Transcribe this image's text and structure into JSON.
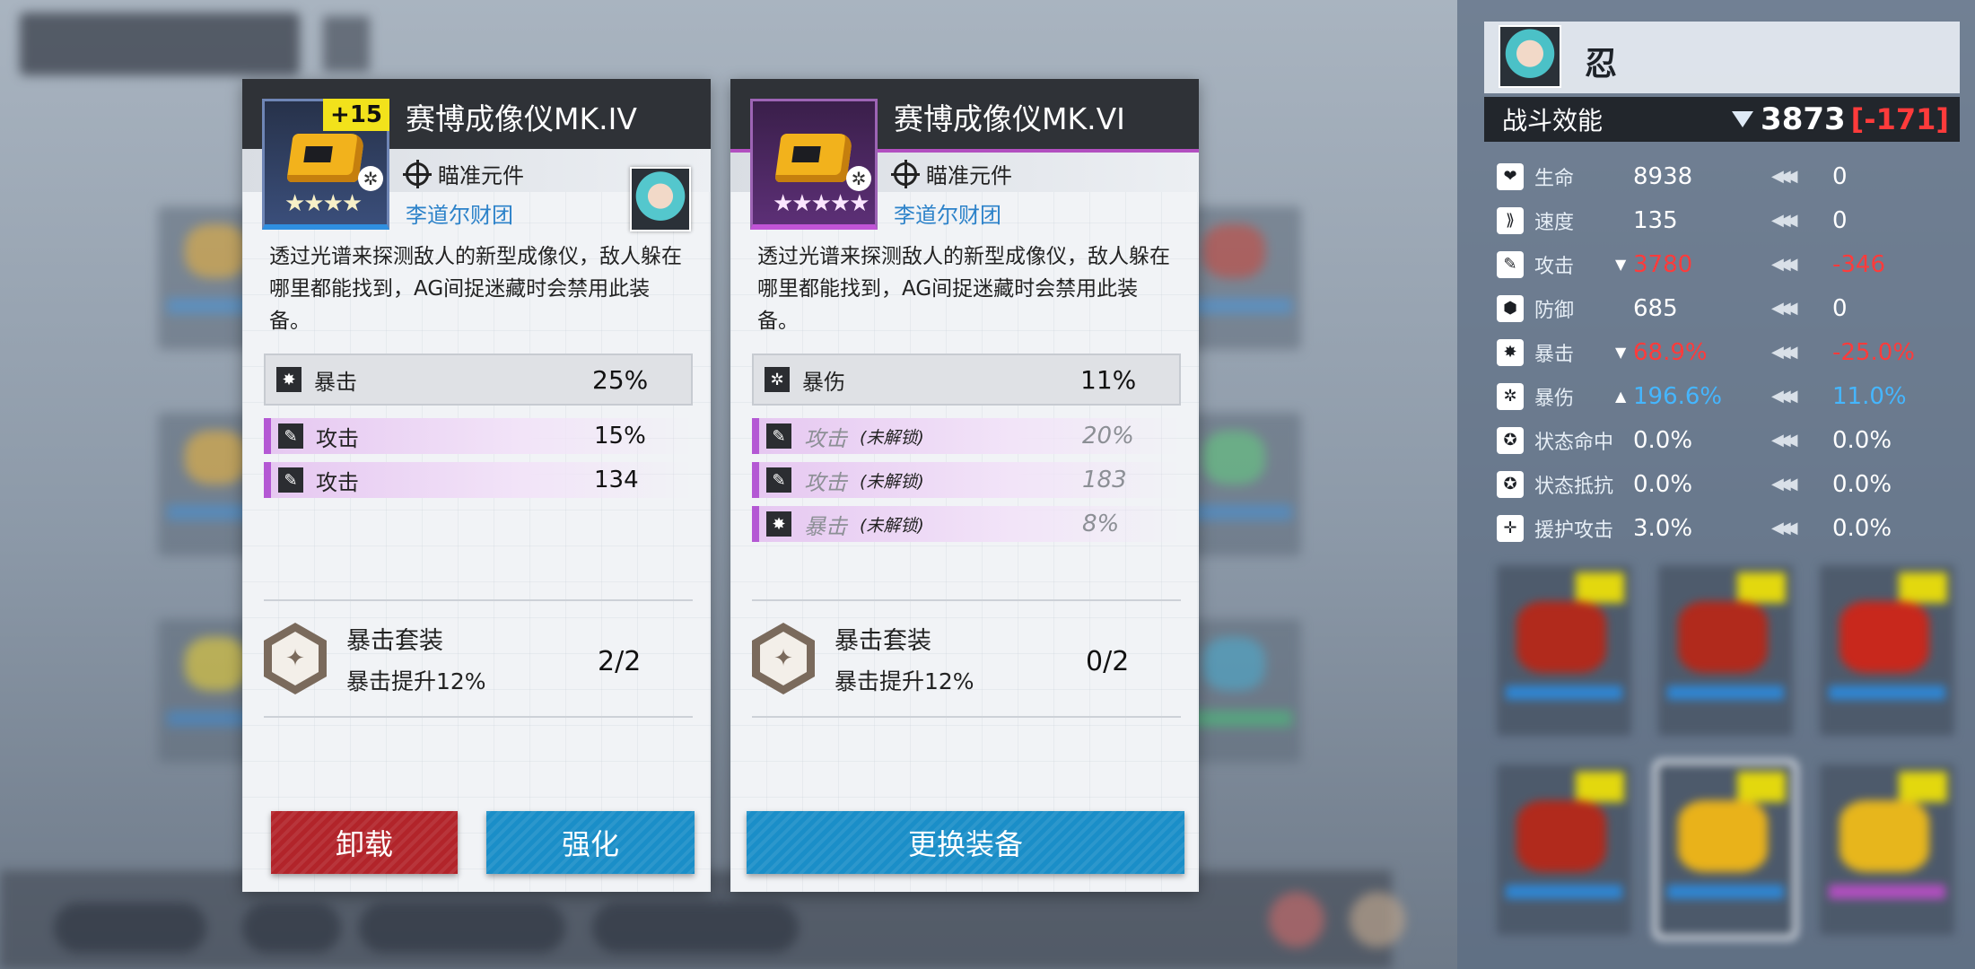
{
  "character": {
    "name": "忍",
    "power_label": "战斗效能",
    "power_value": "3873",
    "power_diff": "[-171]"
  },
  "stats": [
    {
      "icon": "heart-icon",
      "glyph": "❤",
      "name": "生命",
      "arrow": "",
      "value": "8938",
      "diff": "0",
      "trend": ""
    },
    {
      "icon": "speed-icon",
      "glyph": "⟫",
      "name": "速度",
      "arrow": "",
      "value": "135",
      "diff": "0",
      "trend": ""
    },
    {
      "icon": "attack-icon",
      "glyph": "✎",
      "name": "攻击",
      "arrow": "▼",
      "value": "3780",
      "diff": "-346",
      "trend": "down"
    },
    {
      "icon": "defense-icon",
      "glyph": "⬢",
      "name": "防御",
      "arrow": "",
      "value": "685",
      "diff": "0",
      "trend": ""
    },
    {
      "icon": "crit-icon",
      "glyph": "✸",
      "name": "暴击",
      "arrow": "▼",
      "value": "68.9%",
      "diff": "-25.0%",
      "trend": "down"
    },
    {
      "icon": "crit-damage-icon",
      "glyph": "✲",
      "name": "暴伤",
      "arrow": "▲",
      "value": "196.6%",
      "diff": "11.0%",
      "trend": "up"
    },
    {
      "icon": "status-hit-icon",
      "glyph": "✪",
      "name": "状态命中",
      "arrow": "",
      "value": "0.0%",
      "diff": "0.0%",
      "trend": ""
    },
    {
      "icon": "status-resist-icon",
      "glyph": "✪",
      "name": "状态抵抗",
      "arrow": "",
      "value": "0.0%",
      "diff": "0.0%",
      "trend": ""
    },
    {
      "icon": "assist-attack-icon",
      "glyph": "✛",
      "name": "援护攻击",
      "arrow": "",
      "value": "3.0%",
      "diff": "0.0%",
      "trend": ""
    }
  ],
  "card_a": {
    "title": "赛博成像仪MK.IV",
    "level": "+15",
    "stars": "★★★★",
    "type": "瞄准元件",
    "maker": "李道尔财团",
    "description": "透过光谱来探测敌人的新型成像仪，敌人躲在哪里都能找到，AG间捉迷藏时会禁用此装备。",
    "main_stat": {
      "name": "暴击",
      "value": "25%"
    },
    "sub_stats": [
      {
        "name": "攻击",
        "lock": "",
        "value": "15%"
      },
      {
        "name": "攻击",
        "lock": "",
        "value": "134"
      }
    ],
    "set": {
      "name": "暴击套装",
      "effect": "暴击提升12%",
      "count": "2/2"
    },
    "buttons": {
      "unequip": "卸载",
      "enhance": "强化"
    }
  },
  "card_b": {
    "title": "赛博成像仪MK.VI",
    "stars": "★★★★★",
    "type": "瞄准元件",
    "maker": "李道尔财团",
    "description": "透过光谱来探测敌人的新型成像仪，敌人躲在哪里都能找到，AG间捉迷藏时会禁用此装备。",
    "main_stat": {
      "name": "暴伤",
      "value": "11%"
    },
    "sub_stats": [
      {
        "name": "攻击",
        "lock": "(未解锁)",
        "value": "20%"
      },
      {
        "name": "攻击",
        "lock": "(未解锁)",
        "value": "183"
      },
      {
        "name": "暴击",
        "lock": "(未解锁)",
        "value": "8%"
      }
    ],
    "set": {
      "name": "暴击套装",
      "effect": "暴击提升12%",
      "count": "0/2"
    },
    "buttons": {
      "replace": "更换装备"
    }
  }
}
